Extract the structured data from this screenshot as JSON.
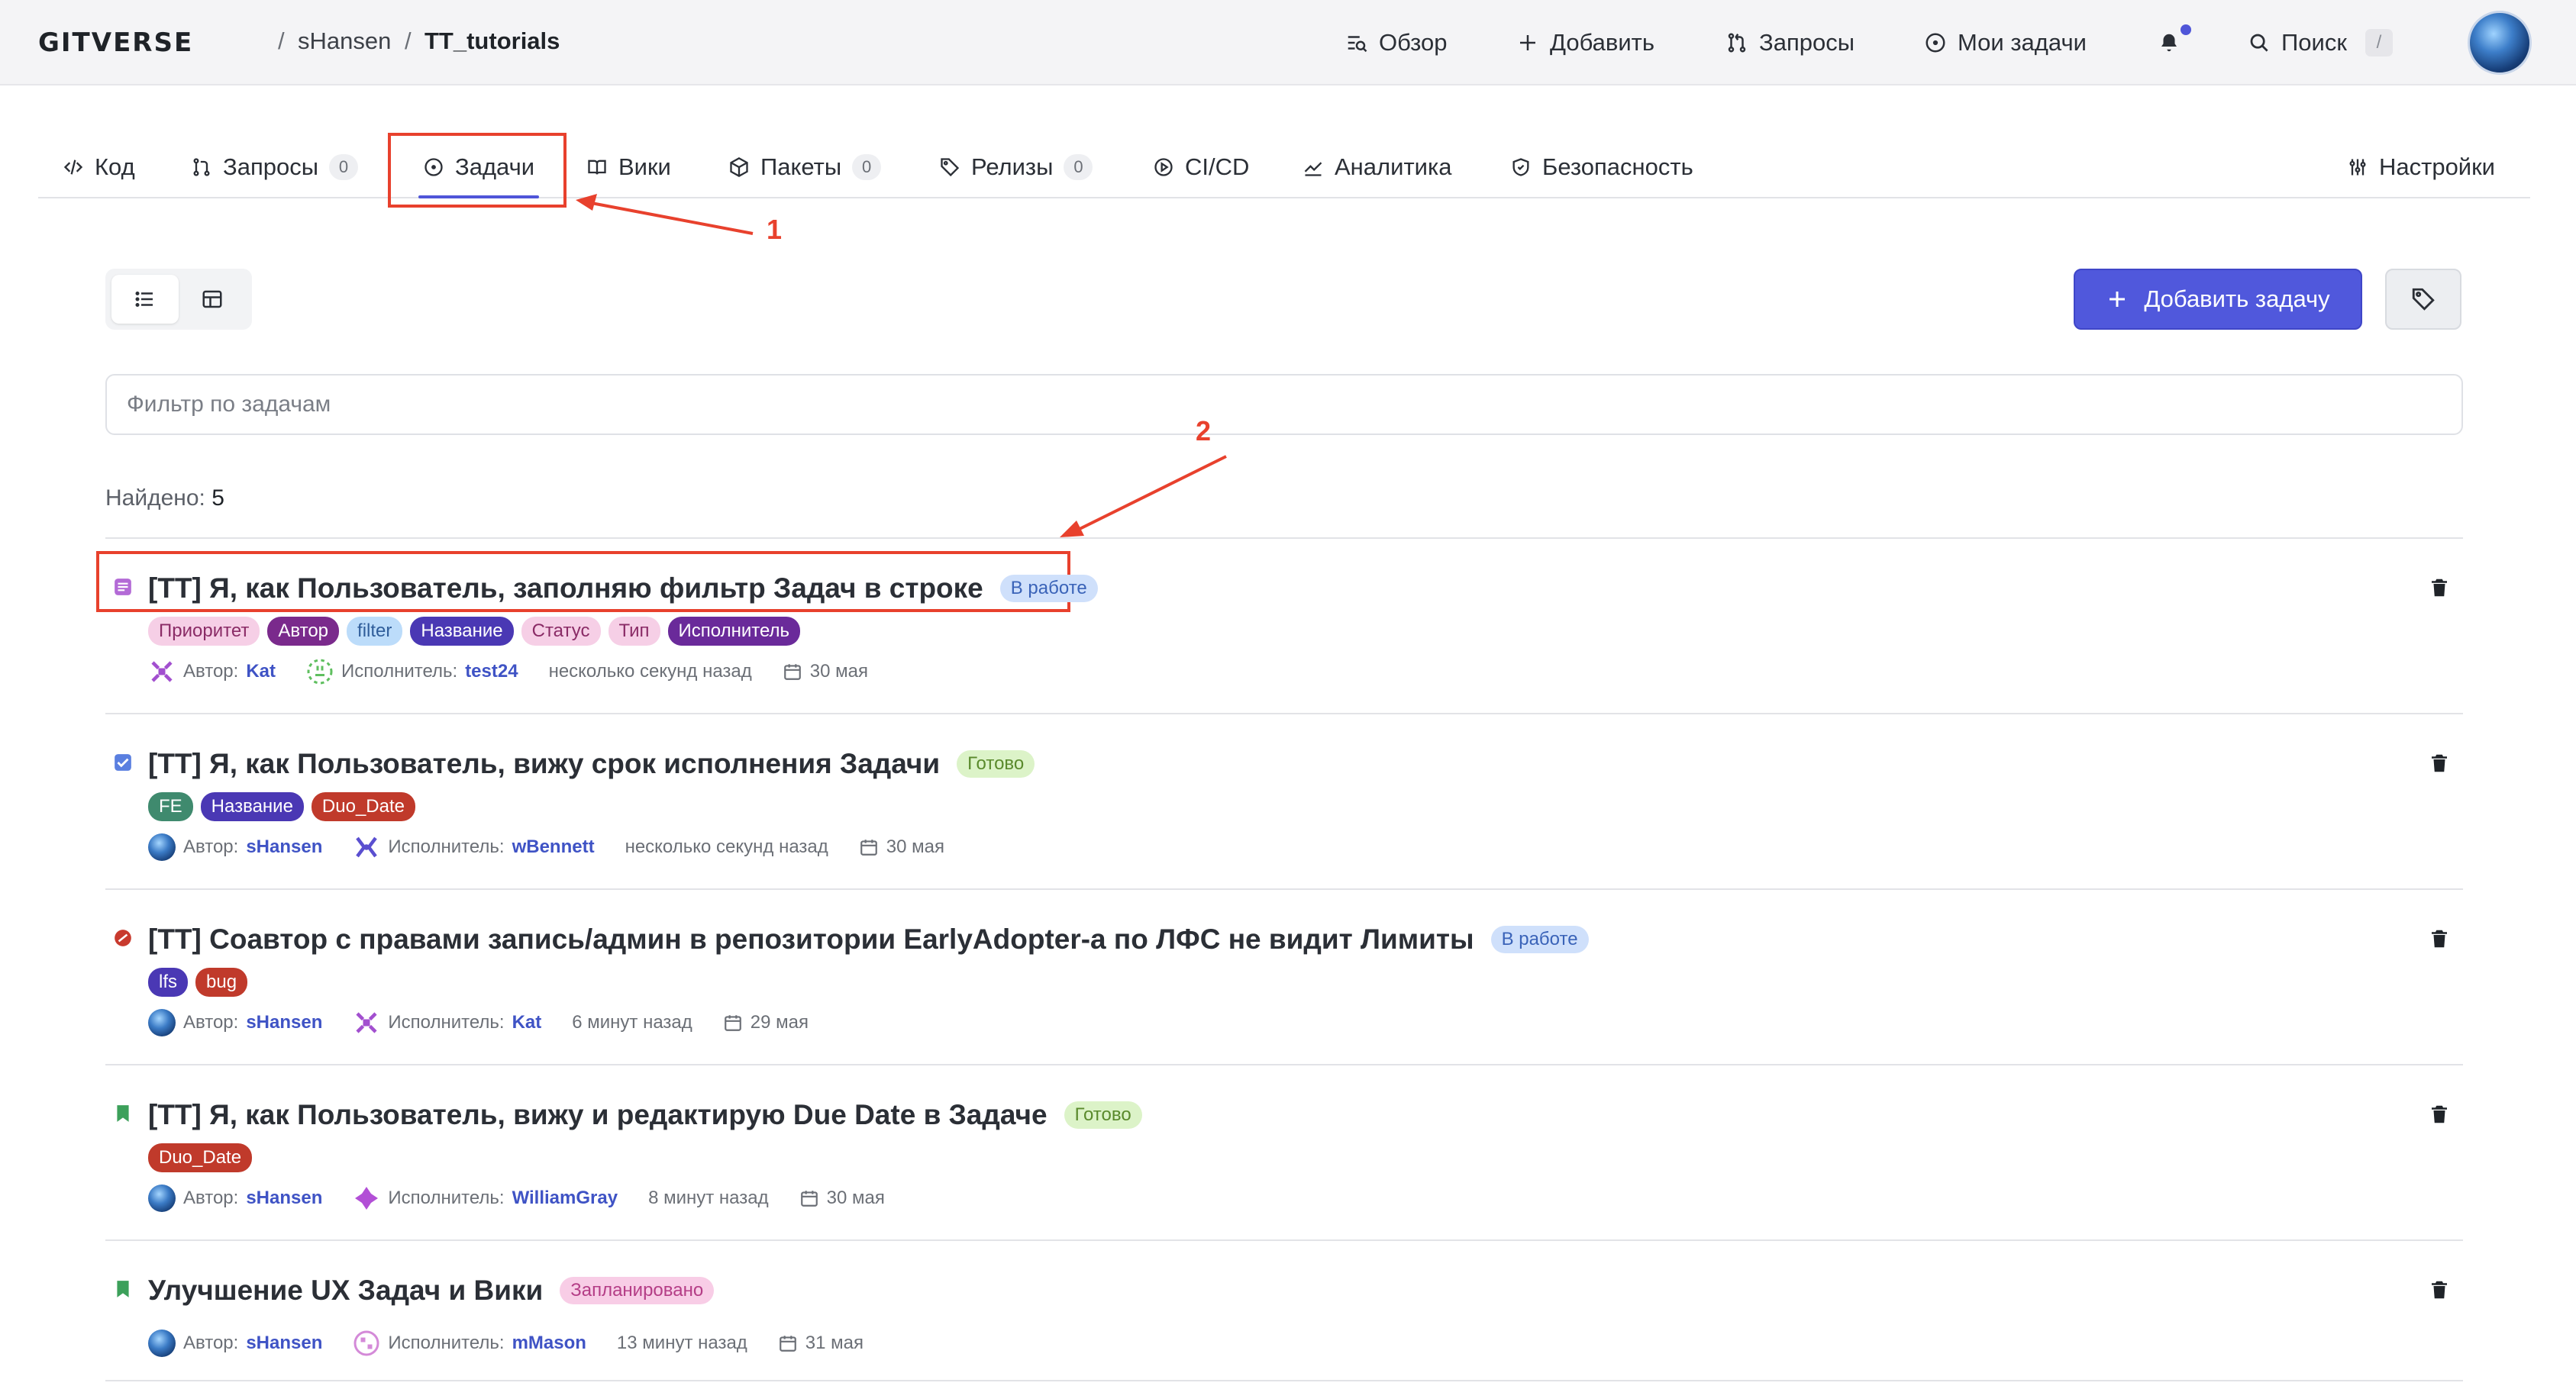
{
  "header": {
    "logo": "GITVERSE",
    "breadcrumb": [
      "sHansen",
      "TT_tutorials"
    ],
    "nav": {
      "overview": "Обзор",
      "add": "Добавить",
      "requests": "Запросы",
      "my_tasks": "Мои задачи",
      "search": "Поиск",
      "search_shortcut": "/"
    }
  },
  "tabs": [
    {
      "label": "Код"
    },
    {
      "label": "Запросы",
      "count": "0"
    },
    {
      "label": "Задачи"
    },
    {
      "label": "Вики"
    },
    {
      "label": "Пакеты",
      "count": "0"
    },
    {
      "label": "Релизы",
      "count": "0"
    },
    {
      "label": "CI/CD"
    },
    {
      "label": "Аналитика"
    },
    {
      "label": "Безопасность"
    },
    {
      "label": "Настройки"
    }
  ],
  "annotations": {
    "first": "1",
    "second": "2"
  },
  "toolbar": {
    "add_task": "Добавить задачу"
  },
  "filter": {
    "placeholder": "Фильтр по задачам"
  },
  "found": {
    "label": "Найдено:",
    "count": "5"
  },
  "meta_labels": {
    "author": "Автор:",
    "assignee": "Исполнитель:"
  },
  "issues": [
    {
      "title": "[TT] Я, как Пользователь, заполняю фильтр Задач в строке",
      "status": "В работе",
      "labels": [
        "Приоритет",
        "Автор",
        "filter",
        "Название",
        "Статус",
        "Тип",
        "Исполнитель"
      ],
      "author": "Kat",
      "assignee": "test24",
      "time": "несколько секунд назад",
      "due": "30 мая"
    },
    {
      "title": "[TT] Я, как Пользователь, вижу срок исполнения Задачи",
      "status": "Готово",
      "labels": [
        "FE",
        "Название",
        "Duo_Date"
      ],
      "author": "sHansen",
      "assignee": "wBennett",
      "time": "несколько секунд назад",
      "due": "30 мая"
    },
    {
      "title": "[TT] Соавтор с правами запись/админ в репозитории EarlyAdopter-а по ЛФС не видит Лимиты",
      "status": "В работе",
      "labels": [
        "lfs",
        "bug"
      ],
      "author": "sHansen",
      "assignee": "Kat",
      "time": "6 минут назад",
      "due": "29 мая"
    },
    {
      "title": "[TT] Я, как Пользователь, вижу и редактирую Due Date в Задаче",
      "status": "Готово",
      "labels": [
        "Duo_Date"
      ],
      "author": "sHansen",
      "assignee": "WilliamGray",
      "time": "8 минут назад",
      "due": "30 мая"
    },
    {
      "title": "Улучшение UX Задач и Вики",
      "status": "Запланировано",
      "labels": [],
      "author": "sHansen",
      "assignee": "mMason",
      "time": "13 минут назад",
      "due": "31 мая"
    }
  ],
  "colors": {
    "accent": "#5058dc",
    "annotation": "#e8412d",
    "label_priority": "#f6cfe6",
    "label_author": "#7a2a8c",
    "label_filter": "#bcdcfa",
    "label_name": "#4a38b4",
    "label_status": "#f6cfe6",
    "label_type": "#f6cfe6",
    "label_assignee": "#6a2a9a",
    "label_fe": "#3f8a6e",
    "label_duodate": "#c03a2b",
    "label_lfs": "#4a38b4",
    "label_bug": "#c03a2b"
  }
}
